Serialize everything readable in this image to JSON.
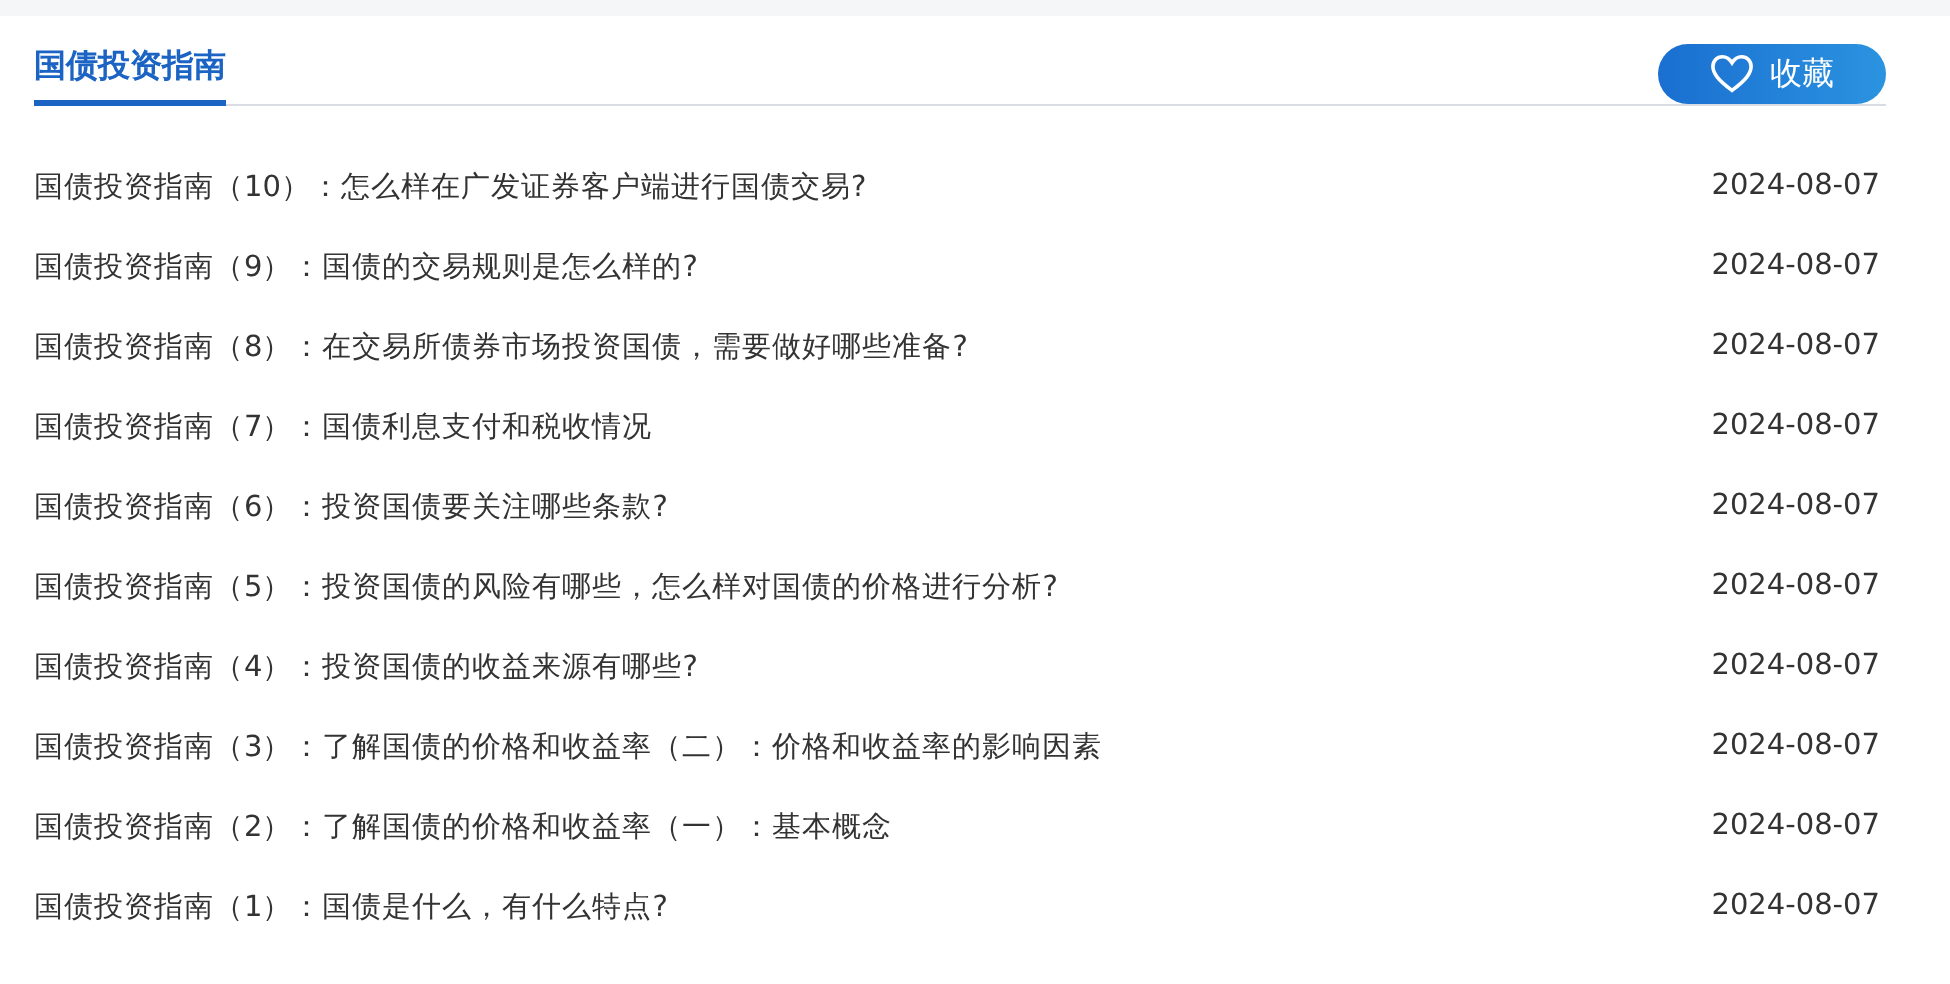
{
  "header": {
    "title": "国债投资指南",
    "favorite_button": "收藏"
  },
  "articles": [
    {
      "title": "国债投资指南（10）：怎么样在广发证券客户端进行国债交易?",
      "date": "2024-08-07"
    },
    {
      "title": "国债投资指南（9）：国债的交易规则是怎么样的?",
      "date": "2024-08-07"
    },
    {
      "title": "国债投资指南（8）：在交易所债券市场投资国债，需要做好哪些准备?",
      "date": "2024-08-07"
    },
    {
      "title": "国债投资指南（7）：国债利息支付和税收情况",
      "date": "2024-08-07"
    },
    {
      "title": "国债投资指南（6）：投资国债要关注哪些条款?",
      "date": "2024-08-07"
    },
    {
      "title": "国债投资指南（5）：投资国债的风险有哪些，怎么样对国债的价格进行分析?",
      "date": "2024-08-07"
    },
    {
      "title": "国债投资指南（4）：投资国债的收益来源有哪些?",
      "date": "2024-08-07"
    },
    {
      "title": "国债投资指南（3）：了解国债的价格和收益率（二）：价格和收益率的影响因素",
      "date": "2024-08-07"
    },
    {
      "title": "国债投资指南（2）：了解国债的价格和收益率（一）：基本概念",
      "date": "2024-08-07"
    },
    {
      "title": "国债投资指南（1）：国债是什么，有什么特点?",
      "date": "2024-08-07"
    }
  ]
}
